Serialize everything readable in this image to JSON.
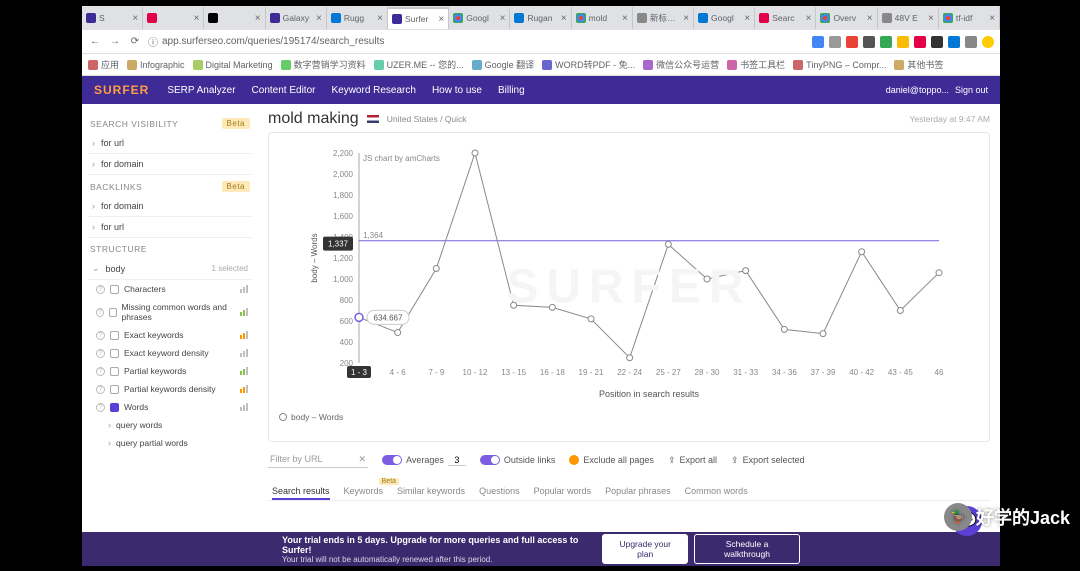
{
  "browser": {
    "tabs": [
      {
        "label": "S",
        "icon": "s"
      },
      {
        "label": "",
        "icon": "r"
      },
      {
        "label": "",
        "icon": "m"
      },
      {
        "label": "Galaxy",
        "icon": "s"
      },
      {
        "label": "Rugg",
        "icon": "b"
      },
      {
        "label": "Surfer",
        "icon": "s",
        "active": true
      },
      {
        "label": "Googl",
        "icon": "g"
      },
      {
        "label": "Rugan",
        "icon": "b"
      },
      {
        "label": "mold",
        "icon": "g"
      },
      {
        "label": "新标签页",
        "icon": ""
      },
      {
        "label": "Googl",
        "icon": "b"
      },
      {
        "label": "Searc",
        "icon": "r"
      },
      {
        "label": "Overv",
        "icon": "g"
      },
      {
        "label": "48V E",
        "icon": ""
      },
      {
        "label": "tf-idf",
        "icon": "g"
      }
    ],
    "url": "app.surferseo.com/queries/195174/search_results",
    "bookmarks": [
      {
        "label": "应用"
      },
      {
        "label": "Infographic"
      },
      {
        "label": "Digital Marketing"
      },
      {
        "label": "数字营销学习资料"
      },
      {
        "label": "UZER.ME -- 您的..."
      },
      {
        "label": "Google 翻译"
      },
      {
        "label": "WORD转PDF - 免..."
      },
      {
        "label": "微信公众号运营"
      },
      {
        "label": "书签工具栏"
      },
      {
        "label": "TinyPNG – Compr..."
      },
      {
        "label": "其他书签"
      }
    ]
  },
  "nav": {
    "logo": "SURFER",
    "links": [
      "SERP Analyzer",
      "Content Editor",
      "Keyword Research",
      "How to use",
      "Billing"
    ],
    "user": "daniel@toppo...",
    "signout": "Sign out"
  },
  "sidebar": {
    "sections": [
      {
        "title": "SEARCH VISIBILITY",
        "badge": "Beta",
        "items": [
          "for url",
          "for domain"
        ]
      },
      {
        "title": "BACKLINKS",
        "badge": "Beta",
        "items": [
          "for domain",
          "for url"
        ]
      },
      {
        "title": "STRUCTURE",
        "items_expanded": true
      }
    ],
    "structure_body": "body",
    "structure_selected": "1 selected",
    "structure_items": [
      {
        "label": "Characters"
      },
      {
        "label": "Missing common words and phrases"
      },
      {
        "label": "Exact keywords"
      },
      {
        "label": "Exact keyword density"
      },
      {
        "label": "Partial keywords"
      },
      {
        "label": "Partial keywords density"
      },
      {
        "label": "Words",
        "checked": true
      },
      {
        "label": "query words",
        "sub": true
      },
      {
        "label": "query partial words",
        "sub": true
      }
    ]
  },
  "query": {
    "title": "mold making",
    "location": "United States / Quick",
    "timestamp": "Yesterday at 9:47 AM"
  },
  "chart_data": {
    "type": "line",
    "title": "",
    "xlabel": "Position in search results",
    "ylabel": "body – Words",
    "ylim": [
      200,
      2200
    ],
    "y_ticks": [
      200,
      400,
      600,
      800,
      1000,
      1200,
      1337,
      1400,
      1600,
      1800,
      2000,
      2200
    ],
    "categories": [
      "1 - 3",
      "4 - 6",
      "7 - 9",
      "10 - 12",
      "13 - 15",
      "16 - 18",
      "19 - 21",
      "22 - 24",
      "25 - 27",
      "28 - 30",
      "31 - 33",
      "34 - 36",
      "37 - 39",
      "40 - 42",
      "43 - 45",
      "46"
    ],
    "values": [
      634.667,
      490,
      1100,
      2200,
      750,
      730,
      620,
      250,
      1330,
      1000,
      1080,
      520,
      480,
      1260,
      700,
      1060
    ],
    "reference_line": 1364,
    "tooltip_value": "634.667",
    "highlight_y_label": "1,337",
    "credit": "JS chart by amCharts",
    "legend": "body – Words"
  },
  "filters": {
    "url_placeholder": "Filter by URL",
    "averages_label": "Averages",
    "averages_value": "3",
    "outside_links": "Outside links",
    "exclude": "Exclude all pages",
    "export_all": "Export all",
    "export_selected": "Export selected"
  },
  "result_tabs": [
    "Search results",
    "Keywords",
    "Similar keywords",
    "Questions",
    "Popular words",
    "Popular phrases",
    "Common words"
  ],
  "result_tab_badge": "Beta",
  "trial": {
    "headline": "Your trial ends in 5 days. Upgrade for more queries and full access to Surfer!",
    "sub": "Your trial will not be automatically renewed after this period.",
    "upgrade": "Upgrade your plan",
    "schedule": "Schedule a walkthrough"
  },
  "overlay": "好学的Jack"
}
